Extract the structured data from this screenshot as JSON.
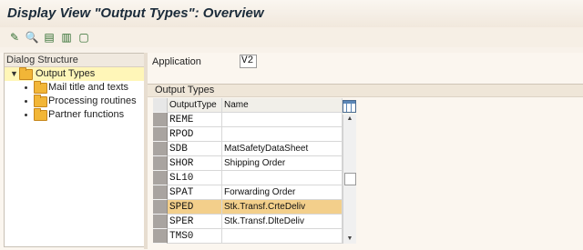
{
  "title": "Display View \"Output Types\": Overview",
  "toolbar": {
    "buttons": [
      {
        "name": "display-change-icon",
        "glyph": "✎"
      },
      {
        "name": "details-icon",
        "glyph": "🔍"
      },
      {
        "name": "select-all-icon",
        "glyph": "▤"
      },
      {
        "name": "select-block-icon",
        "glyph": "▥"
      },
      {
        "name": "deselect-all-icon",
        "glyph": "▢"
      }
    ]
  },
  "dialog_structure": {
    "header": "Dialog Structure",
    "items": [
      {
        "label": "Output Types",
        "level": 0,
        "selected": true
      },
      {
        "label": "Mail title and texts",
        "level": 1
      },
      {
        "label": "Processing routines",
        "level": 1
      },
      {
        "label": "Partner functions",
        "level": 1
      }
    ]
  },
  "application": {
    "label": "Application",
    "value": "V2"
  },
  "output_types": {
    "section_title": "Output Types",
    "columns": [
      "OutputType",
      "Name"
    ],
    "rows": [
      {
        "type": "REME",
        "name": ""
      },
      {
        "type": "RPOD",
        "name": ""
      },
      {
        "type": "SDB",
        "name": "MatSafetyDataSheet"
      },
      {
        "type": "SHOR",
        "name": "Shipping Order"
      },
      {
        "type": "SL10",
        "name": ""
      },
      {
        "type": "SPAT",
        "name": "Forwarding Order"
      },
      {
        "type": "SPED",
        "name": "Stk.Transf.CrteDeliv",
        "highlight": true
      },
      {
        "type": "SPER",
        "name": "Stk.Transf.DlteDeliv"
      },
      {
        "type": "TMS0",
        "name": ""
      }
    ]
  },
  "colors": {
    "highlight": "#f3cf8b",
    "folder": "#f2b637",
    "tree_selected": "#fff6b8"
  }
}
